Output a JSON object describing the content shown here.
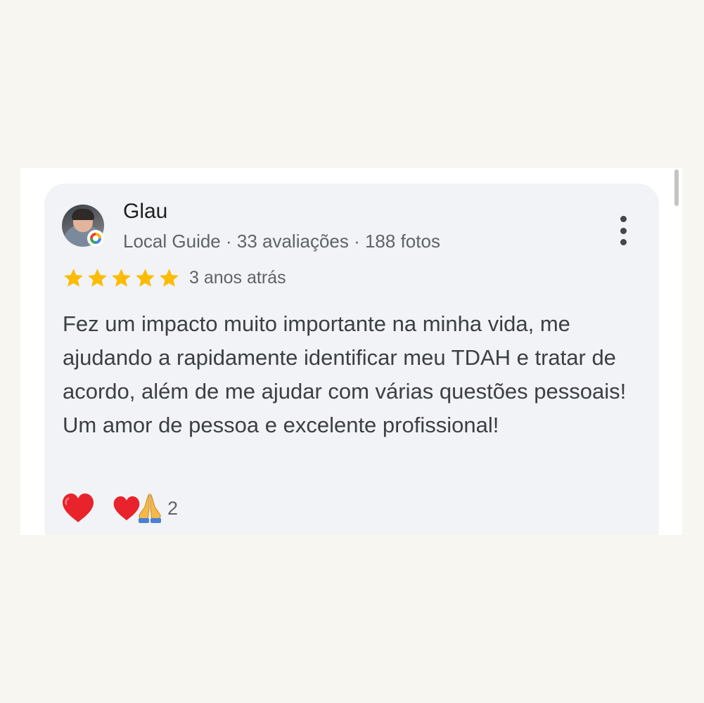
{
  "review": {
    "author_name": "Glau",
    "author_meta": "Local Guide · 33 avaliações · 188 fotos",
    "rating": 5,
    "rating_max": 5,
    "date": "3 anos atrás",
    "text": "Fez um impacto muito importante na minha vida, me ajudando a rapidamente identificar meu TDAH e tratar de acordo, além de me ajudar com várias questões pessoais! Um amor de pessoa e excelente profissional!",
    "reactions_count": "2"
  },
  "icons": {
    "more": "more-vertical-icon",
    "star": "star-icon",
    "like": "heart-icon",
    "summary": [
      "heart-icon",
      "praying-hands-icon"
    ],
    "badge": "local-guide-badge-icon"
  },
  "colors": {
    "page_bg": "#f8f6f1",
    "card_bg": "#f1f3f6",
    "star": "#fbbc04",
    "heart": "#e8232b",
    "text_primary": "#1f1f1f",
    "text_secondary": "#5f6368"
  }
}
